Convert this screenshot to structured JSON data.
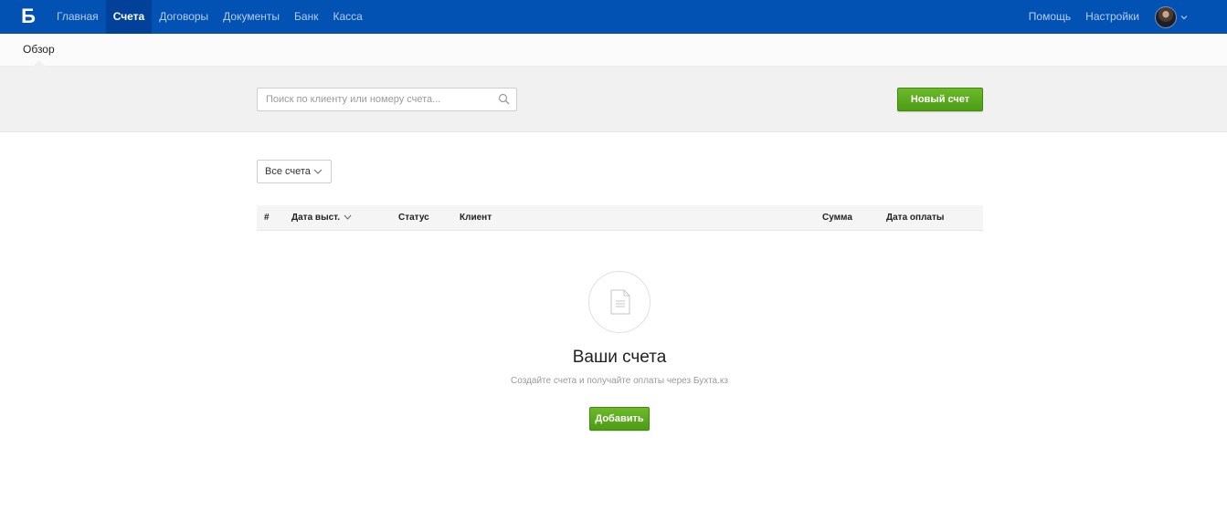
{
  "topbar": {
    "logo": "Б",
    "nav": [
      "Главная",
      "Счета",
      "Договоры",
      "Документы",
      "Банк",
      "Касса"
    ],
    "active_index": 1,
    "right": [
      "Помощь",
      "Настройки"
    ],
    "colors": {
      "bar": "#0252b4",
      "active": "#014199"
    }
  },
  "subnav": {
    "items": [
      "Обзор"
    ]
  },
  "toolbar": {
    "search_placeholder": "Поиск по клиенту или номеру счета...",
    "new_invoice_label": "Новый счет"
  },
  "filter": {
    "selected": "Все счета"
  },
  "table": {
    "columns": [
      "#",
      "Дата выст.",
      "Статус",
      "Клиент",
      "Сумма",
      "Дата оплаты"
    ],
    "sorted_by": "Дата выст."
  },
  "empty_state": {
    "icon": "document-icon",
    "title": "Ваши счета",
    "subtitle": "Создайте счета и получайте оплаты через Бухта.кз",
    "button_label": "Добавить"
  },
  "colors": {
    "accent_green": "#5aab1e"
  }
}
